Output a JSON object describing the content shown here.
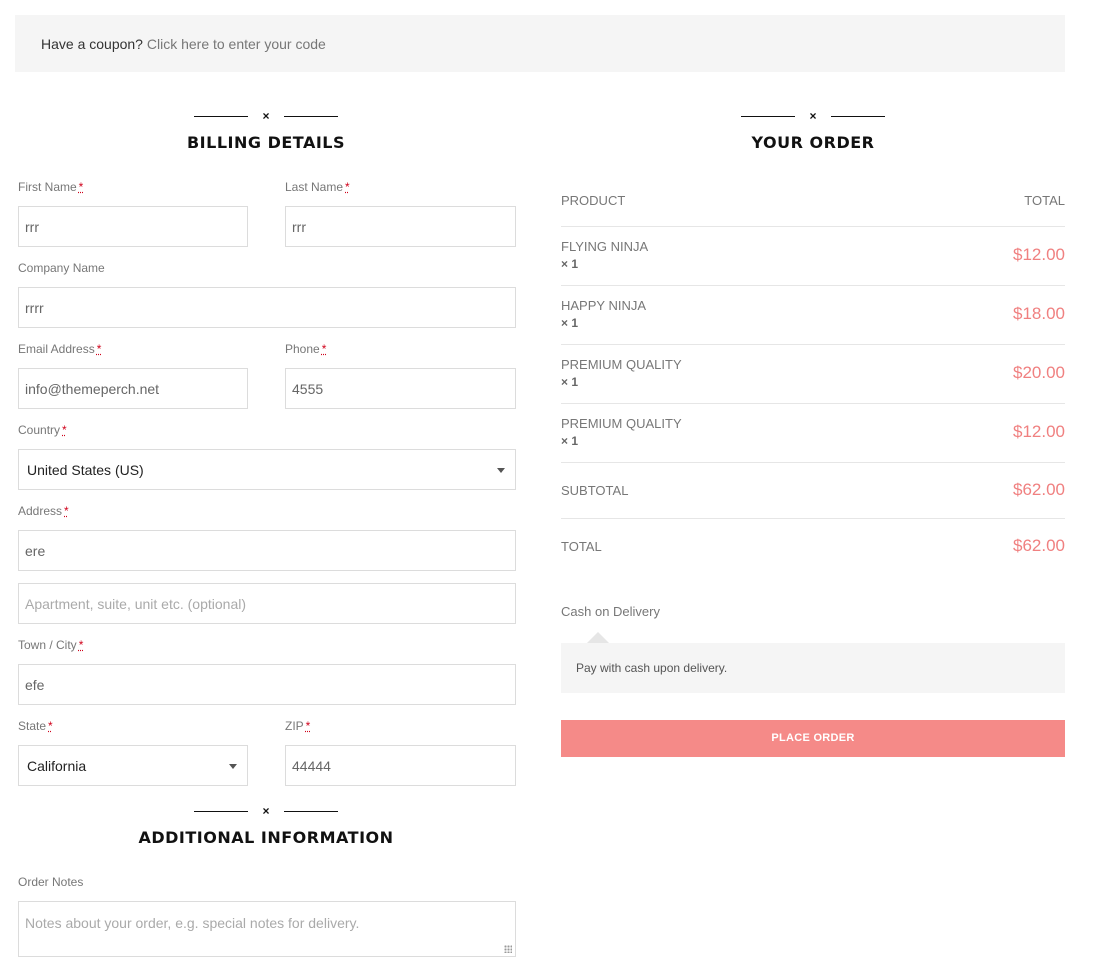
{
  "coupon": {
    "question": "Have a coupon?",
    "link": " Click here to enter your code"
  },
  "billing": {
    "title": "BILLING DETAILS",
    "first_name": {
      "label": "First Name",
      "value": "rrr"
    },
    "last_name": {
      "label": "Last Name",
      "value": "rrr"
    },
    "company": {
      "label": "Company Name",
      "value": "rrrr"
    },
    "email": {
      "label": "Email Address",
      "value": "info@themeperch.net"
    },
    "phone": {
      "label": "Phone",
      "value": "4555"
    },
    "country": {
      "label": "Country",
      "value": "United States (US)"
    },
    "address": {
      "label": "Address",
      "value": "ere",
      "placeholder2": "Apartment, suite, unit etc. (optional)"
    },
    "city": {
      "label": "Town / City",
      "value": "efe"
    },
    "state": {
      "label": "State",
      "value": "California"
    },
    "zip": {
      "label": "ZIP",
      "value": "44444"
    },
    "required_mark": "*"
  },
  "additional": {
    "title": "ADDITIONAL INFORMATION",
    "notes": {
      "label": "Order Notes",
      "placeholder": "Notes about your order, e.g. special notes for delivery."
    }
  },
  "order": {
    "title": "YOUR ORDER",
    "col_product": "PRODUCT",
    "col_total": "TOTAL",
    "items": [
      {
        "name": "FLYING NINJA",
        "qty": "× 1",
        "price": "$12.00"
      },
      {
        "name": "HAPPY NINJA",
        "qty": "× 1",
        "price": "$18.00"
      },
      {
        "name": "PREMIUM QUALITY",
        "qty": "× 1",
        "price": "$20.00"
      },
      {
        "name": "PREMIUM QUALITY",
        "qty": "× 1",
        "price": "$12.00"
      }
    ],
    "subtotal_label": "SUBTOTAL",
    "subtotal": "$62.00",
    "total_label": "TOTAL",
    "total": "$62.00"
  },
  "payment": {
    "method": "Cash on Delivery",
    "description": "Pay with cash upon delivery.",
    "button": "PLACE ORDER"
  },
  "ornament": "×",
  "colors": {
    "accent": "#f58a88",
    "price": "#f08080"
  }
}
